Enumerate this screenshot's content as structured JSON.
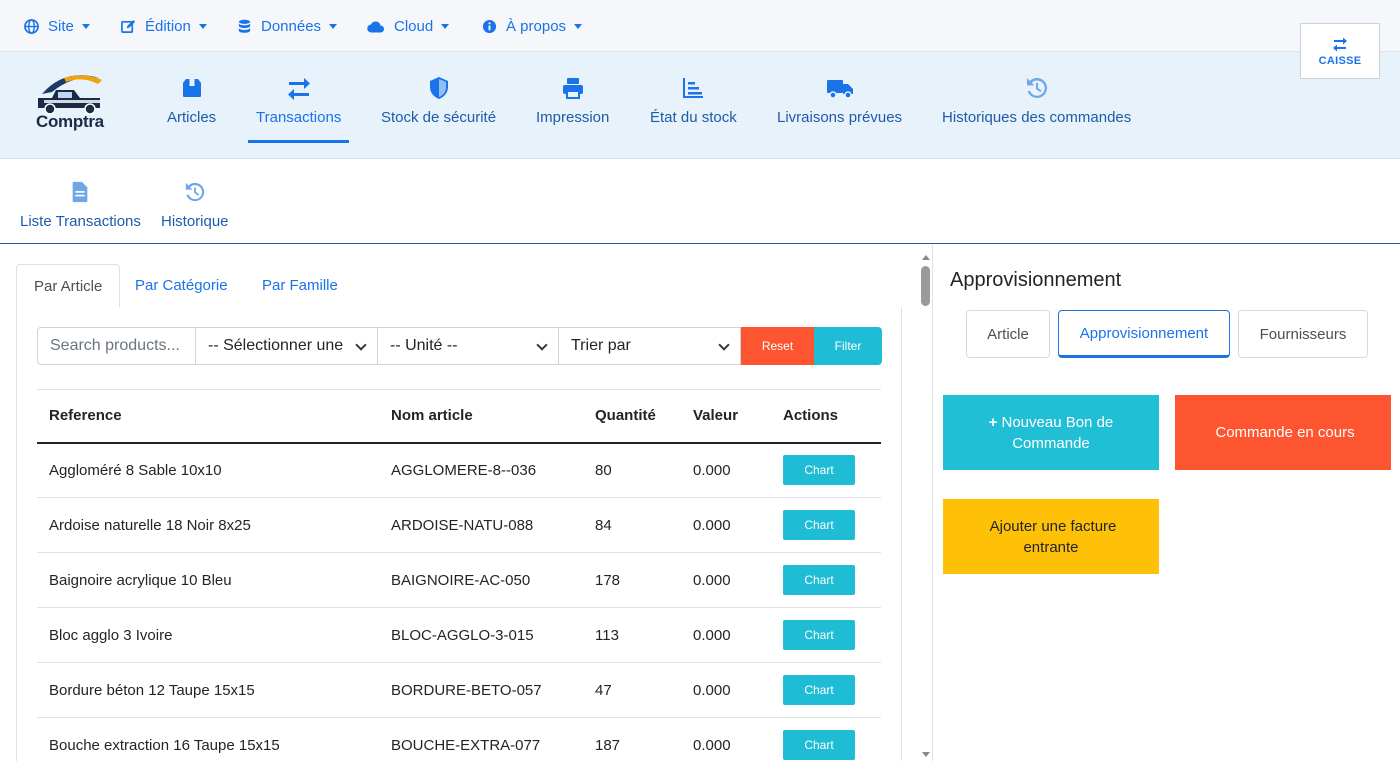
{
  "topmenu": [
    {
      "label": "Site",
      "icon": "globe-icon"
    },
    {
      "label": "Édition",
      "icon": "edit-icon"
    },
    {
      "label": "Données",
      "icon": "database-icon"
    },
    {
      "label": "Cloud",
      "icon": "cloud-icon"
    },
    {
      "label": "À propos",
      "icon": "info-icon"
    }
  ],
  "caisse": {
    "label": "CAISSE",
    "icon": "exchange-icon"
  },
  "brand": {
    "name": "Comptra"
  },
  "mainnav": [
    {
      "label": "Articles",
      "icon": "box-icon"
    },
    {
      "label": "Transactions",
      "icon": "exchange-icon",
      "active": true
    },
    {
      "label": "Stock de sécurité",
      "icon": "shield-icon"
    },
    {
      "label": "Impression",
      "icon": "printer-icon"
    },
    {
      "label": "État du stock",
      "icon": "bar-chart-icon"
    },
    {
      "label": "Livraisons prévues",
      "icon": "truck-icon"
    },
    {
      "label": "Historiques des commandes",
      "icon": "history-icon"
    }
  ],
  "subnav": [
    {
      "label": "Liste Transactions",
      "icon": "file-icon"
    },
    {
      "label": "Historique",
      "icon": "history-icon"
    }
  ],
  "tabs": [
    {
      "label": "Par Article",
      "active": true
    },
    {
      "label": "Par Catégorie"
    },
    {
      "label": "Par Famille"
    }
  ],
  "filters": {
    "search_placeholder": "Search products...",
    "category_select": "-- Sélectionner une",
    "unit_select": "-- Unité --",
    "sort_select": "Trier par",
    "reset_label": "Reset",
    "filter_label": "Filter"
  },
  "table": {
    "headers": [
      "Reference",
      "Nom article",
      "Quantité",
      "Valeur",
      "Actions"
    ],
    "action_label": "Chart",
    "rows": [
      [
        "Aggloméré 8 Sable 10x10",
        "AGGLOMERE-8--036",
        "80",
        "0.000"
      ],
      [
        "Ardoise naturelle 18 Noir 8x25",
        "ARDOISE-NATU-088",
        "84",
        "0.000"
      ],
      [
        "Baignoire acrylique 10 Bleu",
        "BAIGNOIRE-AC-050",
        "178",
        "0.000"
      ],
      [
        "Bloc agglo 3 Ivoire",
        "BLOC-AGGLO-3-015",
        "113",
        "0.000"
      ],
      [
        "Bordure béton 12 Taupe 15x15",
        "BORDURE-BETO-057",
        "47",
        "0.000"
      ],
      [
        "Bouche extraction 16 Taupe 15x15",
        "BOUCHE-EXTRA-077",
        "187",
        "0.000"
      ]
    ]
  },
  "right": {
    "title": "Approvisionnement",
    "buttons": [
      {
        "label": "Article"
      },
      {
        "label": "Approvisionnement",
        "active": true
      },
      {
        "label": "Fournisseurs"
      }
    ],
    "tiles": [
      {
        "glyph": "+",
        "label": "Nouveau Bon de Commande",
        "color": "#20bfd6"
      },
      {
        "glyph": "",
        "label": "Commande en cours",
        "color": "#fd5530"
      },
      {
        "glyph": "",
        "label": "Ajouter une facture entrante",
        "color": "#ffc107"
      }
    ]
  },
  "colors": {
    "accent": "#1a73e8",
    "cyan": "#1fbcd6",
    "orange": "#fd5530",
    "yellow": "#ffc107"
  }
}
